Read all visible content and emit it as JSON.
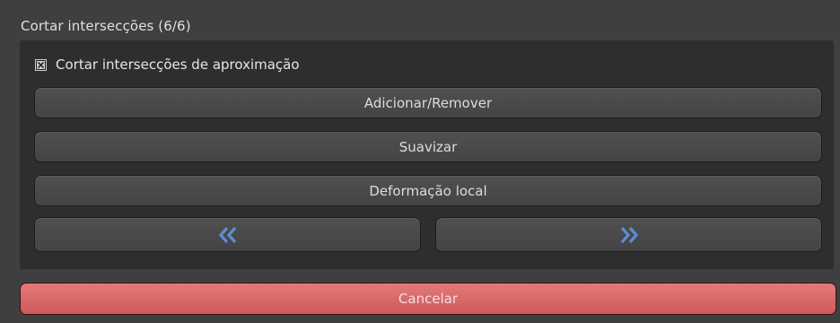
{
  "panel": {
    "title": "Cortar intersecções (6/6)",
    "checkbox": {
      "label": "Cortar intersecções de aproximação",
      "checked": true,
      "icon": "checkbox-checked-icon"
    },
    "buttons": {
      "add_remove": "Adicionar/Remover",
      "smooth": "Suavizar",
      "local_deform": "Deformação local"
    },
    "nav": {
      "prev_icon": "double-chevron-left-icon",
      "next_icon": "double-chevron-right-icon",
      "arrow_color": "#5d8fd6"
    }
  },
  "cancel": {
    "label": "Cancelar",
    "color": "#d96666"
  }
}
